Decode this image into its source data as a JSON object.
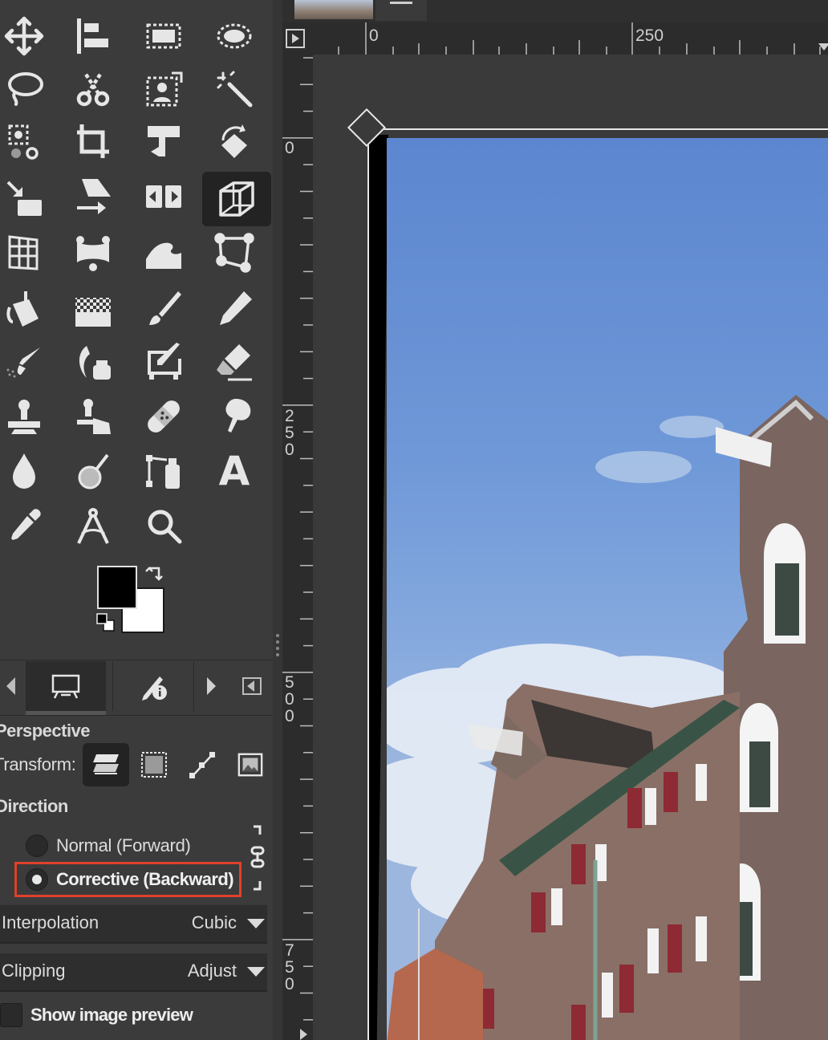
{
  "toolbox": {
    "tools": [
      "move-tool-icon",
      "align-tool-icon",
      "rect-select-icon",
      "ellipse-select-icon",
      "free-select-icon",
      "scissors-select-icon",
      "foreground-select-icon",
      "fuzzy-select-icon",
      "color-select-icon",
      "crop-icon",
      "unified-transform-icon",
      "rotate-icon",
      "scale-icon",
      "shear-icon",
      "flip-icon",
      "perspective-icon",
      "cage-transform-icon",
      "warp-transform-icon",
      "wave-icon",
      "handle-transform-icon",
      "bucket-fill-icon",
      "gradient-icon",
      "paintbrush-icon",
      "pencil-icon",
      "airbrush-icon",
      "ink-icon",
      "mypaint-brush-icon",
      "eraser-icon",
      "clone-icon",
      "perspective-clone-icon",
      "heal-icon",
      "smudge-icon",
      "blur-sharpen-icon",
      "dodge-burn-icon",
      "paths-icon",
      "text-icon",
      "color-picker-icon",
      "measure-icon",
      "zoom-icon",
      ""
    ],
    "active_tool": "perspective-icon",
    "text_tool_glyph": "A",
    "foreground_color": "#000000",
    "background_color": "#ffffff"
  },
  "dock_tabs": {
    "tabs": [
      "tool-options-tab-icon",
      "device-status-tab-icon"
    ]
  },
  "tool_options": {
    "title": "Perspective",
    "transform_label": "Transform:",
    "transform_modes": [
      "layer-icon",
      "selection-icon",
      "path-icon",
      "image-icon"
    ],
    "direction_label": "Direction",
    "direction_options": [
      {
        "label": "Normal (Forward)",
        "selected": false
      },
      {
        "label": "Corrective (Backward)",
        "selected": true
      }
    ],
    "interpolation_label": "Interpolation",
    "interpolation_value": "Cubic",
    "clipping_label": "Clipping",
    "clipping_value": "Adjust",
    "show_preview_label": "Show image preview",
    "show_preview_checked": false
  },
  "rulers": {
    "horizontal_labels": [
      "0",
      "250"
    ],
    "vertical_labels": [
      "0",
      "250",
      "500",
      "750"
    ]
  },
  "highlight_color": "#e0402a"
}
